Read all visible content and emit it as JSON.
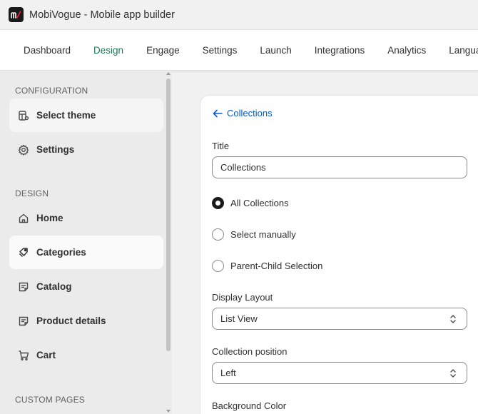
{
  "app": {
    "title": "MobiVogue - Mobile app builder",
    "logo_text": "m/"
  },
  "topnav": {
    "items": [
      {
        "label": "Dashboard"
      },
      {
        "label": "Design"
      },
      {
        "label": "Engage"
      },
      {
        "label": "Settings"
      },
      {
        "label": "Launch"
      },
      {
        "label": "Integrations"
      },
      {
        "label": "Analytics"
      },
      {
        "label": "Language"
      }
    ],
    "active": "Design"
  },
  "sidebar": {
    "configuration_label": "CONFIGURATION",
    "design_label": "DESIGN",
    "custom_pages_label": "CUSTOM PAGES",
    "items": [
      {
        "label": "Select theme",
        "icon": "theme-icon"
      },
      {
        "label": "Settings",
        "icon": "gear-icon"
      },
      {
        "label": "Home",
        "icon": "home-icon"
      },
      {
        "label": "Categories",
        "icon": "tag-icon"
      },
      {
        "label": "Catalog",
        "icon": "catalog-icon"
      },
      {
        "label": "Product details",
        "icon": "product-details-icon"
      },
      {
        "label": "Cart",
        "icon": "cart-icon"
      }
    ],
    "active": "Categories"
  },
  "main": {
    "back_label": "Collections",
    "title_label": "Title",
    "title_value": "Collections",
    "radio_options": [
      {
        "label": "All Collections",
        "checked": true
      },
      {
        "label": "Select manually",
        "checked": false
      },
      {
        "label": "Parent-Child Selection",
        "checked": false
      }
    ],
    "display_layout_label": "Display Layout",
    "display_layout_value": "List View",
    "collection_position_label": "Collection position",
    "collection_position_value": "Left",
    "background_color_label": "Background Color"
  },
  "colors": {
    "accent_nav": "#1d7a57",
    "link": "#005bd3"
  }
}
